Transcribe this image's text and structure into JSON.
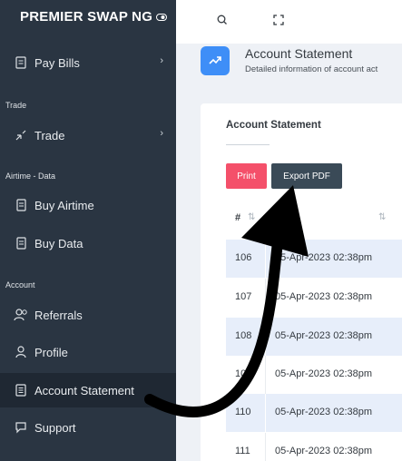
{
  "brand": "PREMIER SWAP NG",
  "sidebar": {
    "items": [
      {
        "label": "Pay Bills",
        "icon": "bill-icon"
      },
      {
        "label": "Trade",
        "icon": "trade-icon"
      },
      {
        "label": "Buy Airtime",
        "icon": "airtime-icon"
      },
      {
        "label": "Buy Data",
        "icon": "data-icon"
      },
      {
        "label": "Referrals",
        "icon": "users-icon"
      },
      {
        "label": "Profile",
        "icon": "user-icon"
      },
      {
        "label": "Account Statement",
        "icon": "statement-icon"
      },
      {
        "label": "Support",
        "icon": "chat-icon"
      }
    ],
    "sections": {
      "trade": "Trade",
      "airtime": "Airtime - Data",
      "account": "Account"
    },
    "active": "Account Statement"
  },
  "page": {
    "title": "Account Statement",
    "subtitle": "Detailed information of account act"
  },
  "card": {
    "title": "Account Statement",
    "print_label": "Print",
    "export_label": "Export PDF",
    "columns": [
      "#"
    ],
    "rows": [
      {
        "id": "106",
        "date": "05-Apr-2023 02:38pm"
      },
      {
        "id": "107",
        "date": "05-Apr-2023 02:38pm"
      },
      {
        "id": "108",
        "date": "05-Apr-2023 02:38pm"
      },
      {
        "id": "109",
        "date": "05-Apr-2023 02:38pm"
      },
      {
        "id": "110",
        "date": "05-Apr-2023 02:38pm"
      },
      {
        "id": "111",
        "date": "05-Apr-2023 02:38pm"
      }
    ]
  },
  "colors": {
    "sidebar": "#2a3542",
    "accent": "#3e8ef7",
    "print": "#f4506a",
    "export": "#3a4a57",
    "stripe": "#e7eefa"
  }
}
